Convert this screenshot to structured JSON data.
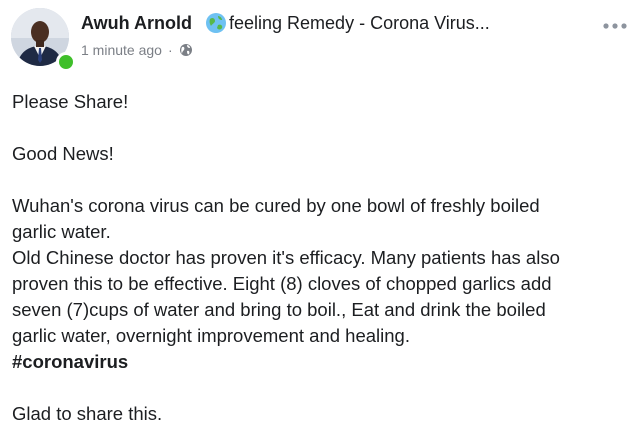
{
  "post": {
    "author_name": "Awuh Arnold",
    "feeling_icon": "globe-emoji-icon",
    "feeling_text": "feeling Remedy - Corona Virus...",
    "timestamp": "1 minute ago",
    "separator": "·",
    "privacy_icon": "globe-icon",
    "more_icon": "more-options-icon",
    "body": {
      "line1": "Please Share!",
      "line2": "Good News!",
      "para1_a": "Wuhan's corona virus can be cured by one bowl of freshly boiled",
      "para1_b": "garlic water.",
      "para2_a": "Old Chinese doctor has proven it's efficacy.  Many patients has also",
      "para2_b": "proven this to be effective. Eight (8) cloves of chopped garlics add",
      "para2_c": "seven (7)cups of water and bring to boil.,  Eat and drink the boiled",
      "para2_d": "garlic water, overnight improvement and healing.",
      "hashtag": "#coronavirus",
      "closing": "Glad to share this."
    }
  }
}
